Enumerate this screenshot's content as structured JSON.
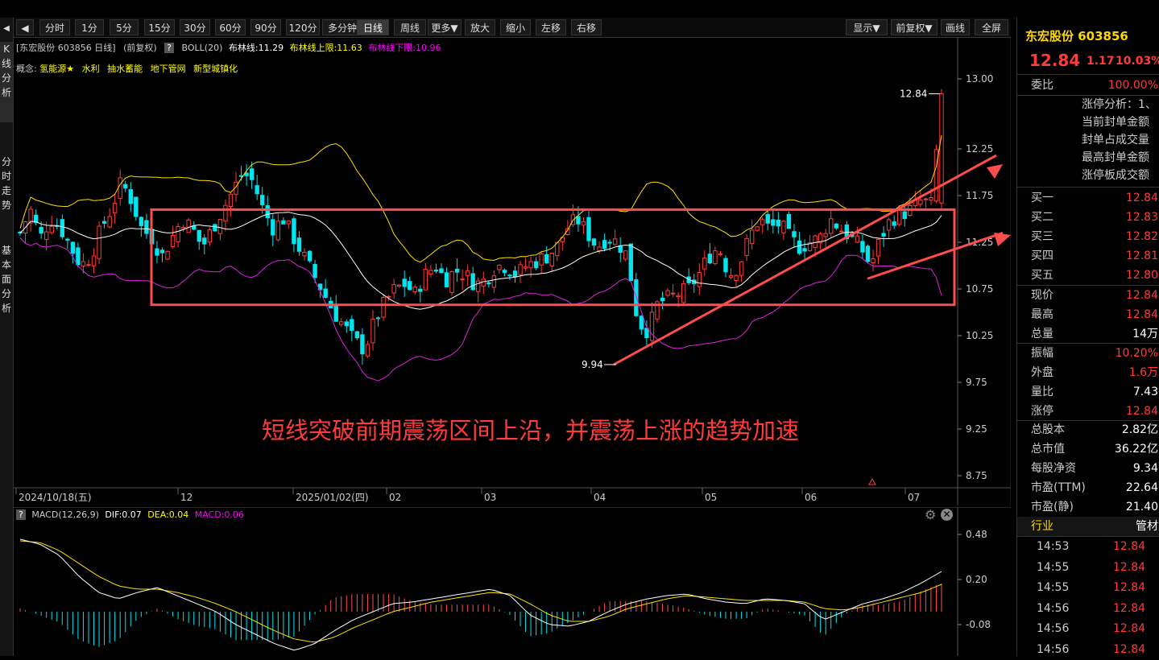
{
  "left_nav": [
    "K线分析",
    "分时走势",
    "基本面分析"
  ],
  "toolbar": {
    "buttons": [
      "分时",
      "1分",
      "5分",
      "15分",
      "30分",
      "60分",
      "90分",
      "120分",
      "多分钟",
      "日线",
      "周线",
      "更多▼",
      "放大",
      "缩小",
      "左移",
      "右移"
    ],
    "active": "日线",
    "right_buttons": [
      "显示▼",
      "前复权▼",
      "画线",
      "全屏"
    ]
  },
  "info": {
    "stock": "[东宏股份 603856 日线]",
    "fq": "(前复权)",
    "help": "?",
    "boll": "BOLL(20)",
    "boll_mid": "布林线:11.29",
    "boll_up": "布林线上限:11.63",
    "boll_low": "布林线下限:10.96"
  },
  "concepts": {
    "label": "概念:",
    "items": [
      "氢能源★",
      "水利",
      "抽水蓄能",
      "地下管网",
      "新型城镇化"
    ]
  },
  "chart_data": [
    {
      "type": "candlestick",
      "title": "东宏股份 603856 日线",
      "ylim": [
        8.75,
        13.0
      ],
      "y_ticks": [
        "13.00",
        "12.25",
        "11.75",
        "11.25",
        "10.75",
        "10.25",
        "9.75",
        "9.25",
        "8.75"
      ],
      "x_labels": [
        "2024/10/18(五)",
        "12",
        "2025/01/02(四)",
        "02",
        "03",
        "04",
        "05",
        "06",
        "07"
      ],
      "annotations": {
        "high": "12.84",
        "low": "9.94"
      },
      "series": [
        {
          "name": "布林线",
          "last": 11.29
        },
        {
          "name": "布林线上限",
          "last": 11.63
        },
        {
          "name": "布林线下限",
          "last": 10.96
        }
      ],
      "close_path": [
        11.35,
        11.6,
        11.3,
        11.5,
        11.4,
        11.2,
        11.0,
        11.1,
        11.4,
        11.6,
        11.9,
        11.7,
        11.4,
        11.3,
        11.1,
        11.3,
        11.5,
        11.4,
        11.2,
        11.4,
        11.6,
        11.8,
        12.0,
        11.9,
        11.6,
        11.4,
        11.5,
        11.3,
        11.1,
        10.9,
        10.7,
        10.5,
        10.35,
        10.2,
        10.1,
        10.4,
        10.6,
        10.75,
        10.8,
        10.7,
        10.9,
        11.0,
        10.85,
        10.95,
        10.9,
        10.8,
        10.85,
        11.0,
        11.0,
        10.9,
        11.0,
        11.05,
        11.1,
        11.2,
        11.4,
        11.5,
        11.35,
        11.2,
        11.3,
        11.25,
        11.1,
        10.4,
        10.3,
        10.6,
        10.65,
        10.7,
        10.75,
        10.9,
        11.1,
        11.2,
        10.9,
        11.0,
        11.3,
        11.5,
        11.4,
        11.45,
        11.3,
        11.2,
        11.25,
        11.3,
        11.5,
        11.4,
        11.3,
        11.2,
        11.0,
        11.3,
        11.5,
        11.55,
        11.6,
        11.7,
        11.65,
        12.84
      ]
    },
    {
      "type": "macd",
      "title": "MACD(12,26,9)",
      "labels": {
        "dif": "DIF:0.07",
        "dea": "DEA:0.04",
        "macd": "MACD:0.06"
      },
      "ylim": [
        -0.25,
        0.55
      ],
      "y_ticks": [
        "0.48",
        "0.20",
        "-0.08"
      ],
      "dif_path": [
        0.45,
        0.42,
        0.35,
        0.22,
        0.12,
        0.08,
        0.12,
        0.15,
        0.1,
        0.05,
        0.0,
        -0.08,
        -0.14,
        -0.2,
        -0.24,
        -0.2,
        -0.12,
        -0.05,
        0.0,
        0.05,
        0.06,
        0.08,
        0.1,
        0.12,
        0.14,
        0.1,
        -0.02,
        -0.08,
        -0.09,
        -0.06,
        0.0,
        0.05,
        0.08,
        0.1,
        0.11,
        0.08,
        0.06,
        0.05,
        0.08,
        0.07,
        0.05,
        -0.05,
        0.0,
        0.05,
        0.08,
        0.12,
        0.18,
        0.25
      ],
      "dea_path": [
        0.44,
        0.43,
        0.38,
        0.3,
        0.22,
        0.16,
        0.14,
        0.14,
        0.12,
        0.09,
        0.05,
        0.0,
        -0.06,
        -0.12,
        -0.17,
        -0.19,
        -0.16,
        -0.1,
        -0.05,
        0.0,
        0.03,
        0.06,
        0.08,
        0.1,
        0.12,
        0.11,
        0.05,
        -0.02,
        -0.06,
        -0.06,
        -0.03,
        0.02,
        0.05,
        0.08,
        0.1,
        0.09,
        0.08,
        0.07,
        0.07,
        0.07,
        0.06,
        0.02,
        0.01,
        0.03,
        0.06,
        0.09,
        0.12,
        0.17
      ]
    }
  ],
  "annotation_text": "短线突破前期震荡区间上沿，并震荡上涨的趋势加速",
  "right_panel": {
    "name": "东宏股份 603856",
    "price": "12.84",
    "change": "1.17",
    "pct": "10.03%",
    "weibi_label": "委比",
    "weibi_val": "100.00%",
    "zt_items": [
      "涨停分析：1、",
      "当前封单金额",
      "封单占成交量",
      "最高封单金额",
      "涨停板成交额"
    ],
    "bids": [
      {
        "label": "买一",
        "val": "12.84"
      },
      {
        "label": "买二",
        "val": "12.83"
      },
      {
        "label": "买三",
        "val": "12.82"
      },
      {
        "label": "买四",
        "val": "12.81"
      },
      {
        "label": "买五",
        "val": "12.80"
      }
    ],
    "quote1": [
      {
        "label": "现价",
        "val": "12.84",
        "color": "red"
      },
      {
        "label": "最高",
        "val": "12.84",
        "color": "red"
      },
      {
        "label": "总量",
        "val": "14万",
        "color": "white"
      }
    ],
    "quote2": [
      {
        "label": "振幅",
        "val": "10.20%",
        "color": "red"
      },
      {
        "label": "外盘",
        "val": "1.6万",
        "color": "red"
      },
      {
        "label": "量比",
        "val": "7.43",
        "color": "white"
      },
      {
        "label": "涨停",
        "val": "12.84",
        "color": "red"
      }
    ],
    "fundamentals": [
      {
        "label": "总股本",
        "val": "2.82亿"
      },
      {
        "label": "总市值",
        "val": "36.22亿"
      },
      {
        "label": "每股净资",
        "val": "9.34"
      },
      {
        "label": "市盈(TTM)",
        "val": "22.64"
      },
      {
        "label": "市盈(静)",
        "val": "21.40"
      }
    ],
    "industry_label": "行业",
    "industry_val": "管材",
    "ticks": [
      {
        "time": "14:53",
        "price": "12.84"
      },
      {
        "time": "14:55",
        "price": "12.84"
      },
      {
        "time": "14:55",
        "price": "12.84"
      },
      {
        "time": "14:56",
        "price": "12.84"
      },
      {
        "time": "14:56",
        "price": "12.84"
      },
      {
        "time": "14:56",
        "price": "12.84"
      }
    ]
  }
}
